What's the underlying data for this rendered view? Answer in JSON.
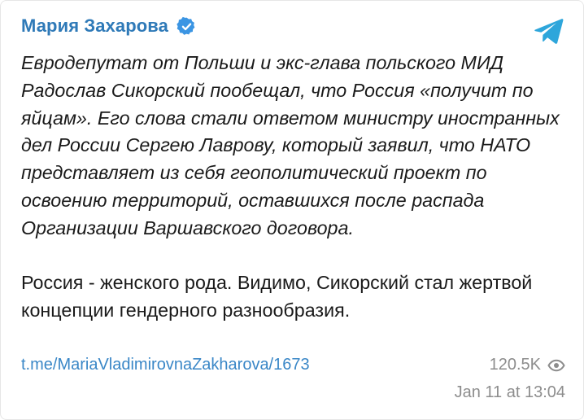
{
  "post": {
    "channel_name": "Мария Захарова",
    "verified_icon": "verified-badge-icon",
    "telegram_icon": "telegram-paper-plane-icon",
    "quote_text": "Евродепутат от Польши и экс-глава польского МИД Радослав Сикорский пообещал, что Россия «получит по яйцам». Его слова стали ответом министру иностранных дел России Сергею Лаврову, который заявил, что НАТО представляет из себя геополитический проект по освоению территорий, оставшихся после распада Организации Варшавского договора.",
    "comment_text": "Россия - женского рода. Видимо, Сикорский стал жертвой концепции гендерного разнообразия.",
    "link_text": "t.me/MariaVladimirovnaZakharova/1673",
    "views": "120.5K",
    "views_icon": "eye-icon",
    "timestamp": "Jan 11 at 13:04"
  },
  "colors": {
    "accent": "#2f7ab8",
    "link": "#3a87c7",
    "meta_text": "#8d8d8d",
    "telegram_blue": "#2ea6db"
  }
}
